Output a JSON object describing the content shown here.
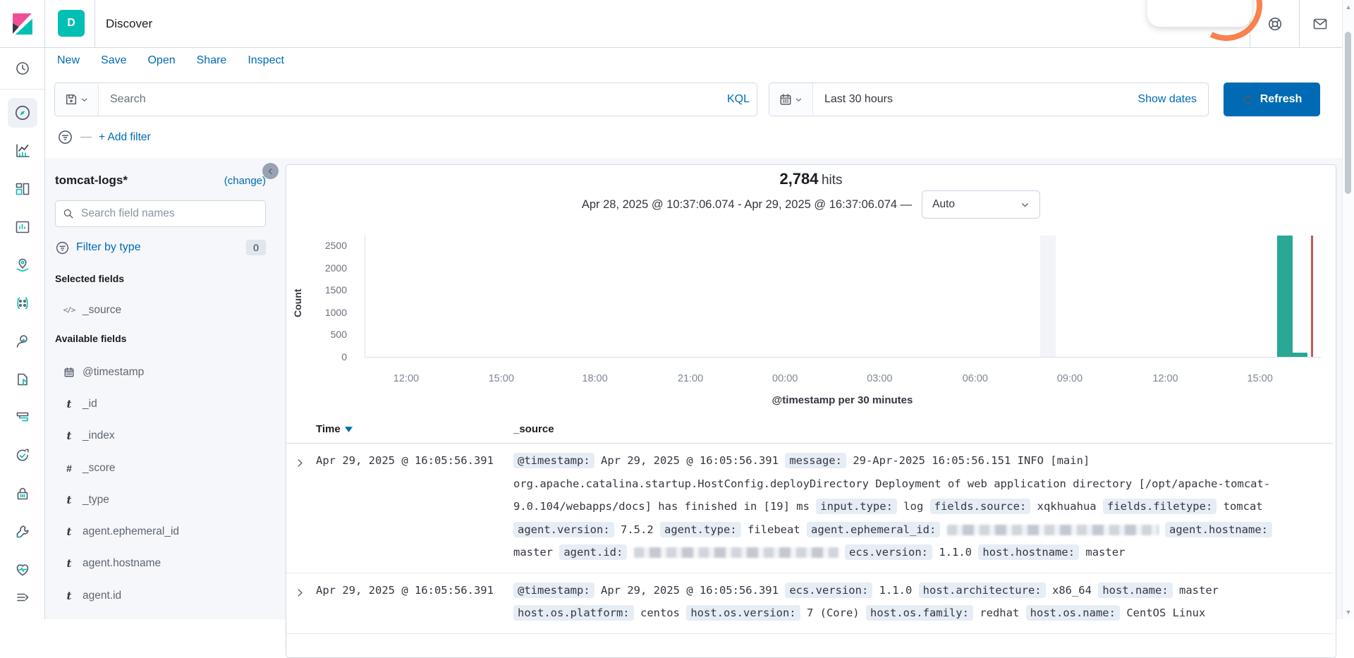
{
  "app": {
    "title": "Discover",
    "badge": "D"
  },
  "topbar": {
    "icons": [
      "help-icon",
      "mail-icon"
    ]
  },
  "menu": {
    "items": [
      "New",
      "Save",
      "Open",
      "Share",
      "Inspect"
    ]
  },
  "query_bar": {
    "search_placeholder": "Search",
    "language": "KQL",
    "time_range": "Last 30 hours",
    "show_dates": "Show dates",
    "refresh": "Refresh",
    "add_filter": "+ Add filter"
  },
  "nav_rail": {
    "items": [
      "recent",
      "discover",
      "visualize",
      "dashboard",
      "canvas",
      "maps",
      "machine-learning",
      "graph",
      "logs",
      "apm",
      "uptime",
      "security",
      "dev-tools",
      "monitoring",
      "collapse-menu"
    ],
    "active": "discover"
  },
  "sidebar": {
    "index_pattern": "tomcat-logs*",
    "change_link": "(change)",
    "search_placeholder": "Search field names",
    "filter_by_type": "Filter by type",
    "filter_count": "0",
    "selected_heading": "Selected fields",
    "selected_fields": [
      {
        "icon": "source-code",
        "name": "_source"
      }
    ],
    "available_heading": "Available fields",
    "available_fields": [
      {
        "icon": "calendar",
        "name": "@timestamp"
      },
      {
        "icon": "string",
        "name": "_id"
      },
      {
        "icon": "string",
        "name": "_index"
      },
      {
        "icon": "number",
        "name": "_score"
      },
      {
        "icon": "string",
        "name": "_type"
      },
      {
        "icon": "string",
        "name": "agent.ephemeral_id"
      },
      {
        "icon": "string",
        "name": "agent.hostname"
      },
      {
        "icon": "string",
        "name": "agent.id"
      }
    ]
  },
  "results": {
    "hits_count": "2,784",
    "hits_label": "hits",
    "time_range_label": "Apr 28, 2025 @ 10:37:06.074 - Apr 29, 2025 @ 16:37:06.074 —",
    "interval_selector": "Auto"
  },
  "chart_data": {
    "type": "bar",
    "title": "2,784 hits",
    "xlabel": "@timestamp per 30 minutes",
    "ylabel": "Count",
    "ylim": [
      0,
      2720
    ],
    "y_ticks": [
      0,
      500,
      1000,
      1500,
      2000,
      2500
    ],
    "x_ticks": [
      "12:00",
      "15:00",
      "18:00",
      "21:00",
      "00:00",
      "03:00",
      "06:00",
      "09:00",
      "12:00",
      "15:00"
    ],
    "x_tick_fractions": [
      0.0435,
      0.143,
      0.241,
      0.341,
      0.44,
      0.539,
      0.639,
      0.738,
      0.838,
      0.937
    ],
    "bars": [
      {
        "x_fraction": 0.954,
        "width_fraction": 0.0163,
        "value": 2720
      },
      {
        "x_fraction": 0.9705,
        "width_fraction": 0.0155,
        "value": 90
      }
    ],
    "annotations": [
      {
        "type": "band",
        "x_fraction": 0.706,
        "width_fraction": 0.0163,
        "label": "empty-bucket-band"
      },
      {
        "type": "line",
        "x_fraction": 0.9895,
        "label": "now-line"
      }
    ],
    "colors": {
      "bar": "#2AA795",
      "now_line": "#C45A55",
      "band": "#F2F4F8"
    },
    "legend": "off",
    "grid": "off"
  },
  "table": {
    "columns": [
      "Time",
      "_source"
    ],
    "rows": [
      {
        "time": "Apr 29, 2025 @ 16:05:56.391",
        "source": [
          {
            "k": "@timestamp:",
            "v": "Apr 29, 2025 @ 16:05:56.391"
          },
          {
            "k": "message:",
            "v": "29-Apr-2025 16:05:56.151 INFO [main] org.apache.catalina.startup.HostConfig.deployDirectory Deployment of web application directory [/opt/apache-tomcat-9.0.104/webapps/docs] has finished in [19] ms"
          },
          {
            "k": "input.type:",
            "v": "log"
          },
          {
            "k": "fields.source:",
            "v": "xqkhuahua"
          },
          {
            "k": "fields.filetype:",
            "v": "tomcat"
          },
          {
            "k": "agent.version:",
            "v": "7.5.2"
          },
          {
            "k": "agent.type:",
            "v": "filebeat"
          },
          {
            "k": "agent.ephemeral_id:",
            "v": "",
            "redacted": true,
            "redacted_width": 300
          },
          {
            "k": "agent.hostname:",
            "v": "master"
          },
          {
            "k": "agent.id:",
            "v": "",
            "redacted": true,
            "redacted_width": 290
          },
          {
            "k": "ecs.version:",
            "v": "1.1.0"
          },
          {
            "k": "host.hostname:",
            "v": "master"
          }
        ]
      },
      {
        "time": "Apr 29, 2025 @ 16:05:56.391",
        "source": [
          {
            "k": "@timestamp:",
            "v": "Apr 29, 2025 @ 16:05:56.391"
          },
          {
            "k": "ecs.version:",
            "v": "1.1.0"
          },
          {
            "k": "host.architecture:",
            "v": "x86_64"
          },
          {
            "k": "host.name:",
            "v": "master"
          },
          {
            "k": "host.os.platform:",
            "v": "centos"
          },
          {
            "k": "host.os.version:",
            "v": "7 (Core)"
          },
          {
            "k": "host.os.family:",
            "v": "redhat"
          },
          {
            "k": "host.os.name:",
            "v": "CentOS Linux"
          }
        ]
      }
    ]
  }
}
